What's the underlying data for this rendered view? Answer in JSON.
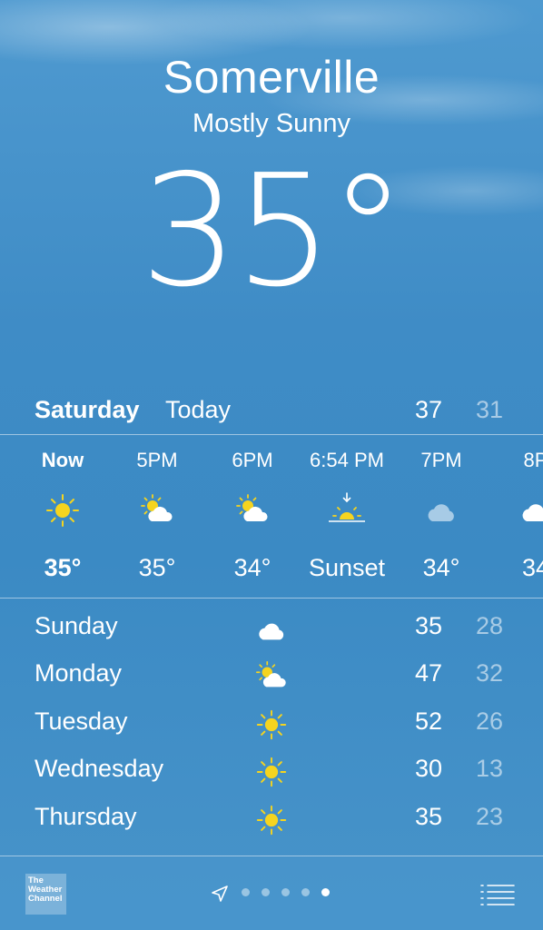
{
  "location": {
    "city": "Somerville",
    "condition": "Mostly Sunny",
    "temperature": "35°"
  },
  "today": {
    "day": "Saturday",
    "label": "Today",
    "high": "37",
    "low": "31"
  },
  "hourly": [
    {
      "time": "Now",
      "icon": "sun-icon",
      "temp": "35°"
    },
    {
      "time": "5PM",
      "icon": "partly-cloudy-icon",
      "temp": "35°"
    },
    {
      "time": "6PM",
      "icon": "partly-cloudy-icon",
      "temp": "34°"
    },
    {
      "time": "6:54 PM",
      "icon": "sunset-icon",
      "temp": "Sunset"
    },
    {
      "time": "7PM",
      "icon": "cloud-icon",
      "temp": "34°"
    },
    {
      "time": "8P",
      "icon": "cloud-icon",
      "temp": "34"
    }
  ],
  "daily": [
    {
      "day": "Sunday",
      "icon": "cloud-icon",
      "high": "35",
      "low": "28"
    },
    {
      "day": "Monday",
      "icon": "partly-cloudy-icon",
      "high": "47",
      "low": "32"
    },
    {
      "day": "Tuesday",
      "icon": "sun-icon",
      "high": "52",
      "low": "26"
    },
    {
      "day": "Wednesday",
      "icon": "sun-icon",
      "high": "30",
      "low": "13"
    },
    {
      "day": "Thursday",
      "icon": "sun-icon",
      "high": "35",
      "low": "23"
    }
  ],
  "toolbar": {
    "logo_lines": [
      "The",
      "Weather",
      "Channel"
    ],
    "page_count": 5,
    "active_page": 5
  },
  "colors": {
    "sun": "#f5d41f",
    "cloud": "#ffffff",
    "background": "#3f8cc6"
  }
}
